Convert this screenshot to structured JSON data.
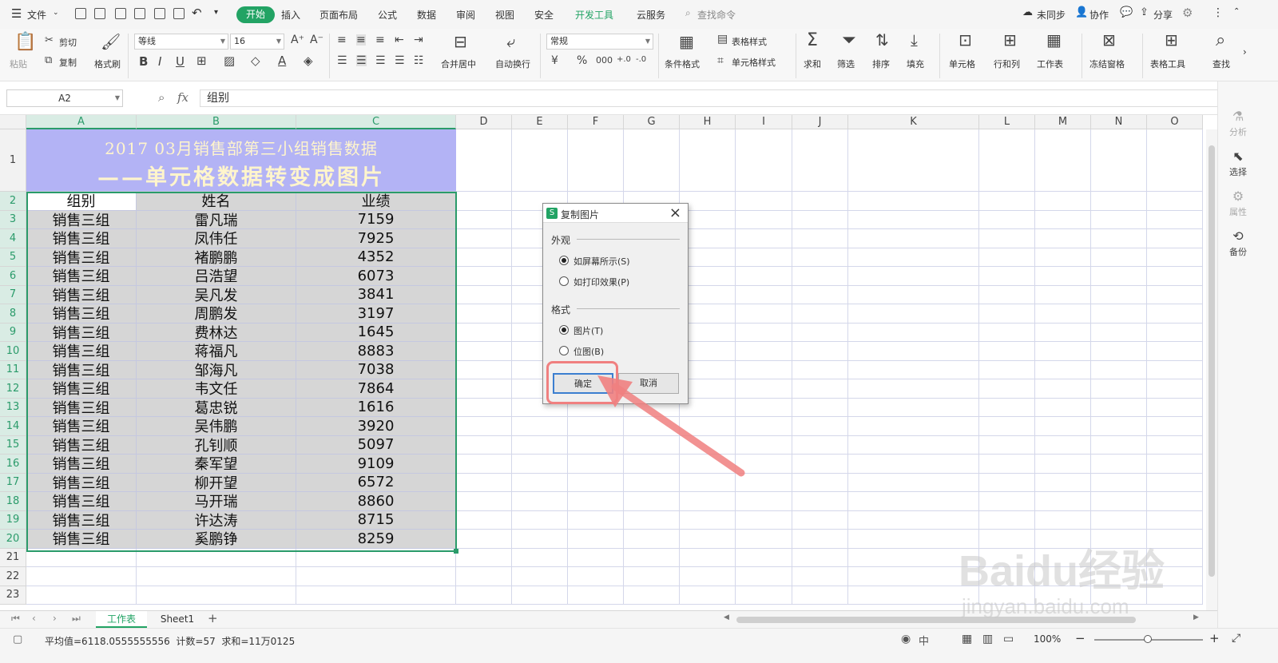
{
  "menubar": {
    "file_label": "文件",
    "tabs": [
      "开始",
      "插入",
      "页面布局",
      "公式",
      "数据",
      "审阅",
      "视图",
      "安全",
      "开发工具",
      "云服务"
    ],
    "active_tab": "开始",
    "search_placeholder": "查找命令",
    "right_items": [
      "未同步",
      "协作",
      "分享"
    ]
  },
  "ribbon": {
    "paste": "粘贴",
    "cut": "剪切",
    "copy": "复制",
    "format_painter": "格式刷",
    "font_name": "等线",
    "font_size": "16",
    "merge_center": "合并居中",
    "wrap_text": "自动换行",
    "number_format": "常规",
    "conditional_format": "条件格式",
    "table_style": "表格样式",
    "cell_style": "单元格样式",
    "sum": "求和",
    "filter": "筛选",
    "sort": "排序",
    "fill": "填充",
    "cell": "单元格",
    "row_col": "行和列",
    "worksheet": "工作表",
    "freeze": "冻结窗格",
    "table_tools": "表格工具",
    "find": "查找"
  },
  "formula_bar": {
    "cell_ref": "A2",
    "fx": "fx",
    "content": "组别"
  },
  "columns": [
    "A",
    "B",
    "C",
    "D",
    "E",
    "F",
    "G",
    "H",
    "I",
    "J",
    "K",
    "L",
    "M",
    "N",
    "O"
  ],
  "sheet": {
    "title_line1": "2017 03月销售部第三小组销售数据",
    "title_line2": "——单元格数据转变成图片",
    "headers": [
      "组别",
      "姓名",
      "业绩"
    ],
    "rows": [
      [
        "销售三组",
        "雷凡瑞",
        "7159"
      ],
      [
        "销售三组",
        "凤伟任",
        "7925"
      ],
      [
        "销售三组",
        "褚鹏鹏",
        "4352"
      ],
      [
        "销售三组",
        "吕浩望",
        "6073"
      ],
      [
        "销售三组",
        "吴凡发",
        "3841"
      ],
      [
        "销售三组",
        "周鹏发",
        "3197"
      ],
      [
        "销售三组",
        "费林达",
        "1645"
      ],
      [
        "销售三组",
        "蒋福凡",
        "8883"
      ],
      [
        "销售三组",
        "邹海凡",
        "7038"
      ],
      [
        "销售三组",
        "韦文任",
        "7864"
      ],
      [
        "销售三组",
        "葛忠锐",
        "1616"
      ],
      [
        "销售三组",
        "吴伟鹏",
        "3920"
      ],
      [
        "销售三组",
        "孔钊顺",
        "5097"
      ],
      [
        "销售三组",
        "秦军望",
        "9109"
      ],
      [
        "销售三组",
        "柳开望",
        "6572"
      ],
      [
        "销售三组",
        "马开瑞",
        "8860"
      ],
      [
        "销售三组",
        "许达涛",
        "8715"
      ],
      [
        "销售三组",
        "奚鹏铮",
        "8259"
      ]
    ],
    "row_numbers": [
      "1",
      "2",
      "3",
      "4",
      "5",
      "6",
      "7",
      "8",
      "9",
      "10",
      "11",
      "12",
      "13",
      "14",
      "15",
      "16",
      "17",
      "18",
      "19",
      "20",
      "21",
      "22",
      "23"
    ]
  },
  "dialog": {
    "title": "复制图片",
    "appearance_group": "外观",
    "opt_screen": "如屏幕所示(S)",
    "opt_print": "如打印效果(P)",
    "format_group": "格式",
    "opt_picture": "图片(T)",
    "opt_bitmap": "位图(B)",
    "ok": "确定",
    "cancel": "取消"
  },
  "sheet_tabs": [
    "工作表",
    "Sheet1"
  ],
  "status": {
    "text": "平均值=6118.0555555556  计数=57  求和=11万0125",
    "zoom": "100%"
  },
  "right_panel": [
    "分析",
    "选择",
    "属性",
    "备份"
  ],
  "watermark": {
    "brand": "Baidu经验",
    "url": "jingyan.baidu.com"
  },
  "colors": {
    "accent_green": "#22a364",
    "title_bg": "#b3b3f5",
    "title_text": "#fff5cc",
    "selected_fill": "#d6d6d6",
    "selection_border": "#2a9b6a",
    "arrow": "#f08080"
  }
}
